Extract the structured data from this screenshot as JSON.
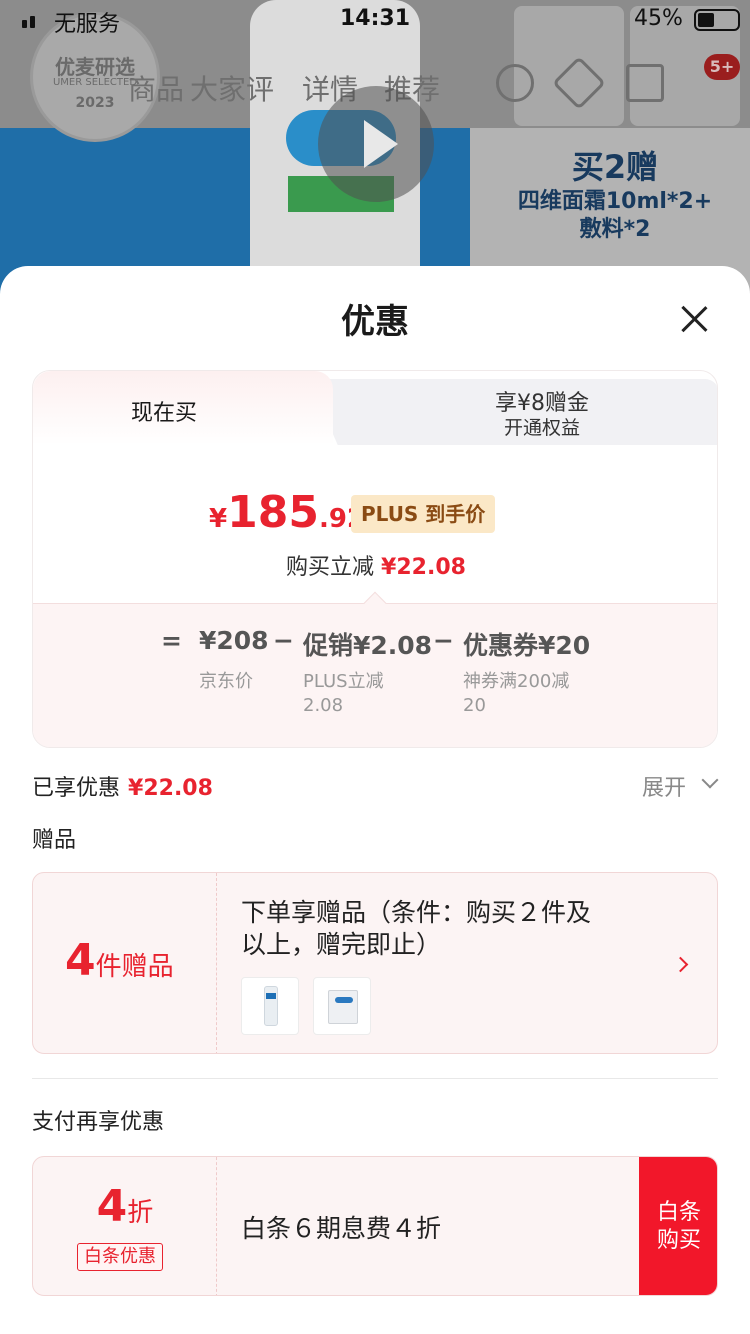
{
  "status_bar": {
    "carrier": "无服务",
    "time": "14:31",
    "battery": "45%"
  },
  "background": {
    "seal": {
      "line1": "优麦研选",
      "line2": "UMER SELECTED",
      "line3": "2023"
    },
    "nav_tabs": [
      "商品",
      "大家评",
      "详情",
      "推荐"
    ],
    "notification_count": "5+",
    "promo": {
      "title": "买2赠",
      "line1": "四维面霜10ml*2+",
      "line2": "敷料*2"
    }
  },
  "sheet": {
    "title": "优惠",
    "tabs": {
      "now": "现在买",
      "plus_title": "享¥8赠金",
      "plus_sub": "开通权益"
    },
    "price": {
      "currency": "¥",
      "integer": "185",
      "decimal": ".92",
      "tag": "PLUS 到手价"
    },
    "reduce": {
      "label": "购买立减",
      "value": "¥22.08"
    },
    "breakdown": {
      "equals": "=",
      "minus": "−",
      "base_value": "¥208",
      "base_label": "京东价",
      "promo_value": "促销¥2.08",
      "promo_label_line1": "PLUS立减",
      "promo_label_line2": "2.08",
      "coupon_value": "优惠券¥20",
      "coupon_label_line1": "神券满200减",
      "coupon_label_line2": "20"
    },
    "enjoyed": {
      "label": "已享优惠",
      "value": "¥22.08",
      "expand": "展开"
    },
    "gift_section_label": "赠品",
    "gift": {
      "count_number": "4",
      "count_text": "件赠品",
      "desc_line1": "下单享赠品（条件：购买２件及",
      "desc_line2": "以上，赠完即止）"
    },
    "pay_section_label": "支付再享优惠",
    "pay": {
      "discount_number": "4",
      "discount_text": "折",
      "tag": "白条优惠",
      "desc": "白条６期息费４折",
      "button_line1": "白条",
      "button_line2": "购买"
    }
  },
  "colors": {
    "accent_red": "#e8232f",
    "button_red": "#f2172a",
    "plus_tag_bg": "#fbe8c7",
    "plus_tag_text": "#8a4b14"
  }
}
